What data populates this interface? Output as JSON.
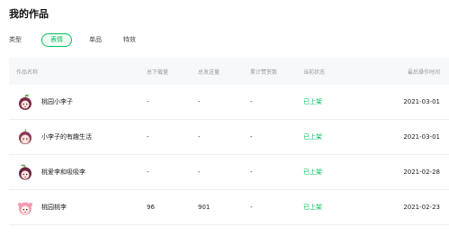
{
  "page": {
    "title": "我的作品"
  },
  "filter": {
    "label": "类型",
    "tabs": [
      {
        "label": "表情",
        "active": true
      },
      {
        "label": "单品",
        "active": false
      },
      {
        "label": "特效",
        "active": false
      }
    ]
  },
  "table": {
    "headers": [
      "作品名称",
      "总下载量",
      "总发送量",
      "累计赞赏数",
      "当前状态",
      "最后操作时间"
    ],
    "rows": [
      {
        "name": "桃园小李子",
        "downloads": "-",
        "sends": "-",
        "rewards": "-",
        "status": "已上架",
        "time": "2021-03-01",
        "avatar": "plum-girl-icon"
      },
      {
        "name": "小李子的有趣生活",
        "downloads": "-",
        "sends": "-",
        "rewards": "-",
        "status": "已上架",
        "time": "2021-03-01",
        "avatar": "plum-girl-icon"
      },
      {
        "name": "桃爱李和吸吸李",
        "downloads": "-",
        "sends": "-",
        "rewards": "-",
        "status": "已上架",
        "time": "2021-02-28",
        "avatar": "plum-girl-icon"
      },
      {
        "name": "桃园桃李",
        "downloads": "96",
        "sends": "901",
        "rewards": "-",
        "status": "已上架",
        "time": "2021-02-23",
        "avatar": "peach-girl-icon"
      }
    ]
  },
  "colors": {
    "accent": "#07c160",
    "header_bg": "#f7f8f9"
  }
}
